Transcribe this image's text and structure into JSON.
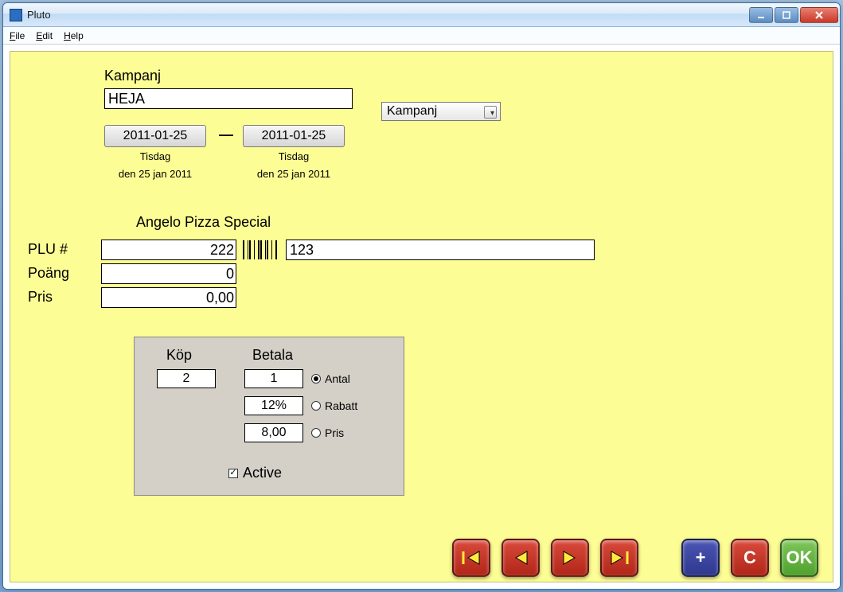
{
  "window": {
    "title": "Pluto"
  },
  "menu": {
    "file": "File",
    "edit": "Edit",
    "help": "Help"
  },
  "campaign": {
    "label": "Kampanj",
    "name": "HEJA",
    "typeSelected": "Kampanj",
    "dateFrom": "2011-01-25",
    "dateTo": "2011-01-25",
    "dayFrom": "Tisdag",
    "dayTo": "Tisdag",
    "longFrom": "den 25 jan 2011",
    "longTo": "den 25 jan 2011",
    "separator": "—"
  },
  "product": {
    "name": "Angelo Pizza Special",
    "labels": {
      "plu": "PLU #",
      "points": "Poäng",
      "price": "Pris"
    },
    "plu": "222",
    "points": "0",
    "price": "0,00",
    "barcodeValue": "123"
  },
  "buyPanel": {
    "headers": {
      "buy": "Köp",
      "pay": "Betala"
    },
    "buyQty": "2",
    "payQty": "1",
    "discount": "12%",
    "payPrice": "8,00",
    "radios": {
      "antal": "Antal",
      "rabatt": "Rabatt",
      "pris": "Pris"
    },
    "selected": "antal",
    "activeChecked": true,
    "activeLabel": "Active"
  },
  "buttons": {
    "ok": "OK",
    "clear": "C",
    "plus": "+"
  }
}
